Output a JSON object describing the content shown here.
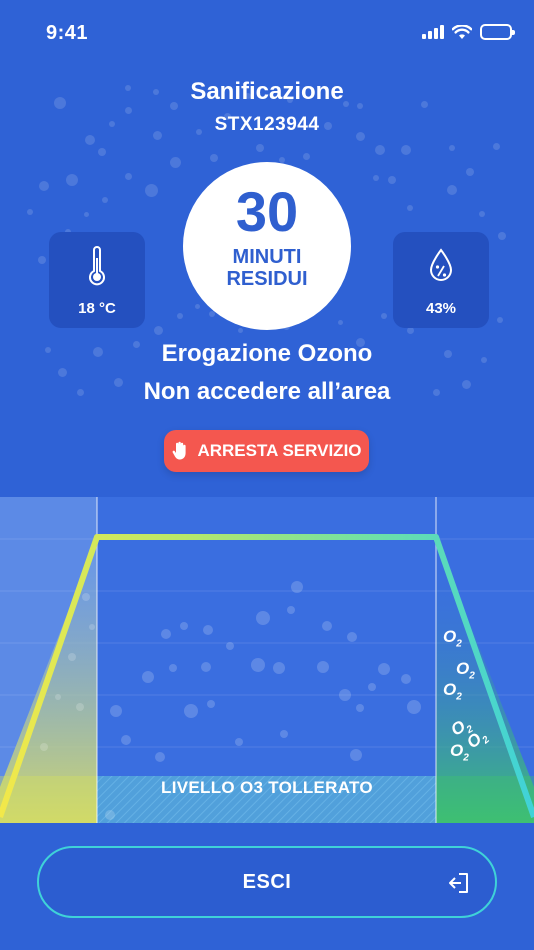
{
  "status_bar": {
    "time": "9:41",
    "icons": [
      "signal-icon",
      "wifi-icon",
      "battery-icon"
    ]
  },
  "header": {
    "title": "Sanificazione",
    "device_id": "STX123944"
  },
  "timer": {
    "value": "30",
    "unit": "MINUTI",
    "label": "RESIDUI"
  },
  "temperature": {
    "icon": "thermometer-icon",
    "value": "18 °C"
  },
  "humidity": {
    "icon": "humidity-drop-icon",
    "value": "43%"
  },
  "messages": {
    "line1": "Erogazione Ozono",
    "line2": "Non accedere all’area"
  },
  "stop_button": {
    "icon": "hand-stop-icon",
    "label": "ARRESTA SERVIZIO"
  },
  "chart": {
    "tolerated_label": "LIVELLO O3 TOLLERATO",
    "molecule_label": "O",
    "molecule_sub": "2"
  },
  "exit_button": {
    "label": "ESCI",
    "icon": "exit-icon"
  },
  "colors": {
    "background": "#2f62d6",
    "stop_button": "#f4574f",
    "timer_text": "#2f5fcf",
    "exit_border": "#3fd2d8",
    "curve_start": "#f2e84a",
    "curve_end": "#3fd2d8"
  }
}
